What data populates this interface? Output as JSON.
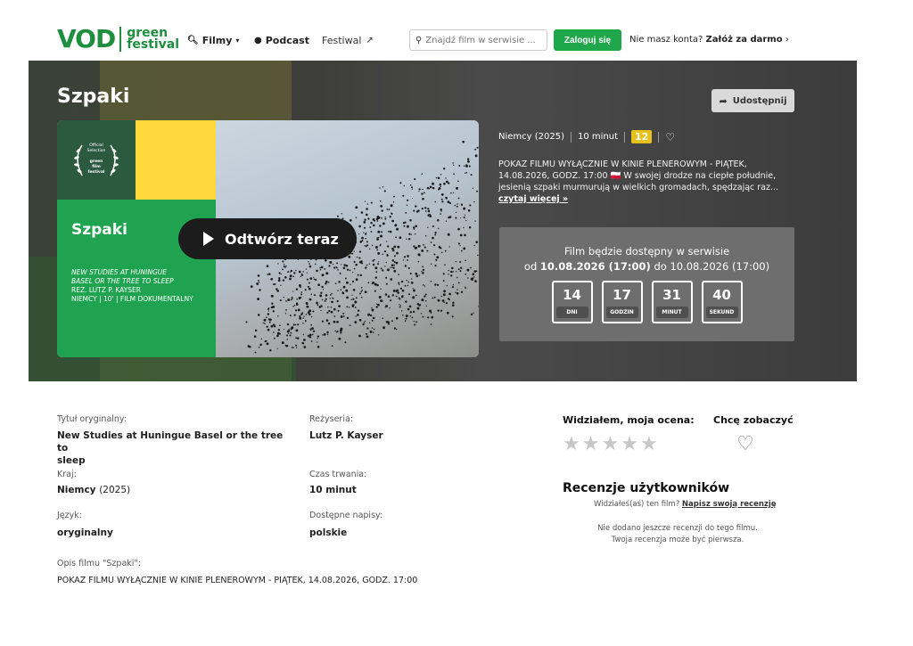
{
  "header": {
    "logo_main": "VOD",
    "logo_line1": "green",
    "logo_line2": "festival",
    "nav_filmy": "Filmy",
    "nav_podcast": "Podcast",
    "nav_festiwal": "Festiwal",
    "search_placeholder": "Znajdź film w serwisie ...",
    "login_label": "Zaloguj się",
    "no_account_text": "Nie masz konta?",
    "signup_label": "Załóż za darmo",
    "signup_arrow": "›"
  },
  "hero": {
    "title": "Szpaki",
    "share_label": "Udostępnij",
    "poster": {
      "badge_l1": "Official",
      "badge_l2": "Selection",
      "badge_l3": "green",
      "badge_l4": "film",
      "badge_l5": "festival",
      "film_name": "Szpaki",
      "credit_title1": "NEW STUDIES AT HUNINGUE",
      "credit_title2": "BASEL OR THE TREE TO SLEEP",
      "credit_dir": "REZ. LUTZ P. KAYSER",
      "credit_info": "NIEMCY | 10' | FILM DOKUMENTALNY"
    },
    "play_label": "Odtwórz teraz",
    "meta_country": "Niemcy (2025)",
    "meta_duration": "10 minut",
    "meta_age": "12",
    "description": "POKAZ FILMU WYŁĄCZNIE W KINIE PLENEROWYM - PIĄTEK, 14.08.2026, GODZ. 17:00 🇵🇱 W swojej drodze na ciepłe południe, jesienią szpaki murmurują w wielkich gromadach, spędzając raz...",
    "read_more": "czytaj więcej »",
    "availability": {
      "line1": "Film będzie dostępny w serwisie",
      "from_word": "od",
      "from_date": "10.08.2026 (17:00)",
      "to_word": "do",
      "to_date": "10.08.2026 (17:00)"
    },
    "countdown": [
      {
        "num": "14",
        "label": "DNI"
      },
      {
        "num": "17",
        "label": "GODZIN"
      },
      {
        "num": "31",
        "label": "MINUT"
      },
      {
        "num": "40",
        "label": "SEKUND"
      }
    ]
  },
  "details": {
    "orig_title_label": "Tytuł oryginalny:",
    "orig_title_l1": "New Studies at Huningue Basel or the tree to",
    "orig_title_l2": "sleep",
    "director_label": "Reżyseria:",
    "director": "Lutz P. Kayser",
    "country_label": "Kraj:",
    "country": "Niemcy",
    "year": "(2025)",
    "duration_label": "Czas trwania:",
    "duration": "10 minut",
    "language_label": "Język:",
    "language": "oryginalny",
    "subs_label": "Dostępne napisy:",
    "subs": "polskie",
    "synopsis_label": "Opis filmu \"Szpaki\":",
    "synopsis": "POKAZ FILMU WYŁĄCZNIE W KINIE PLENEROWYM - PIĄTEK, 14.08.2026, GODZ. 17:00"
  },
  "rating": {
    "seen_label": "Widziałem, moja ocena:",
    "want_label": "Chcę zobaczyć",
    "stars": 0,
    "reviews_title": "Recenzje użytkowników",
    "seen_question": "Widziałeś(aś) ten film?",
    "write_review": "Napisz swoją recenzję",
    "empty_l1": "Nie dodano jeszcze recenzji do tego filmu.",
    "empty_l2": "Twoja recenzja może być pierwsza."
  },
  "colors": {
    "brand_green": "#1e8f3e",
    "button_green": "#1fa84b",
    "age_badge": "#e8c21c"
  }
}
